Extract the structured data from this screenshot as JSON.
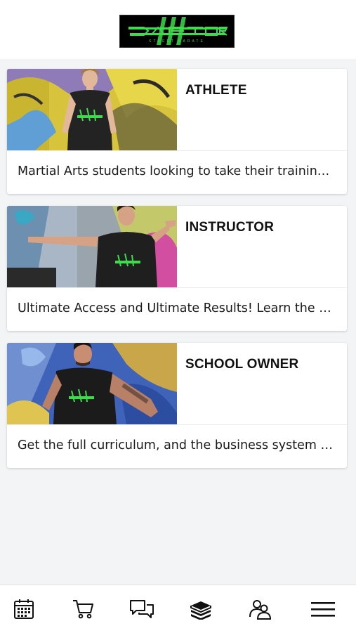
{
  "header": {
    "logo_text": "RAPTOR",
    "logo_subtext": "STREET KARATE"
  },
  "cards": [
    {
      "title": "ATHLETE",
      "description": "Martial Arts students looking to take their training to the next level"
    },
    {
      "title": "INSTRUCTOR",
      "description": "Ultimate Access and Ultimate Results! Learn the complete system"
    },
    {
      "title": "SCHOOL OWNER",
      "description": "Get the full curriculum, and the business system to grow your school"
    }
  ],
  "bottom_nav": [
    {
      "icon": "calendar-icon"
    },
    {
      "icon": "cart-icon"
    },
    {
      "icon": "chat-icon"
    },
    {
      "icon": "books-icon"
    },
    {
      "icon": "community-icon"
    },
    {
      "icon": "menu-icon"
    }
  ],
  "colors": {
    "background": "#f3f4f6",
    "card": "#ffffff",
    "logo_green": "#3ddc4a",
    "logo_bg": "#000000"
  }
}
